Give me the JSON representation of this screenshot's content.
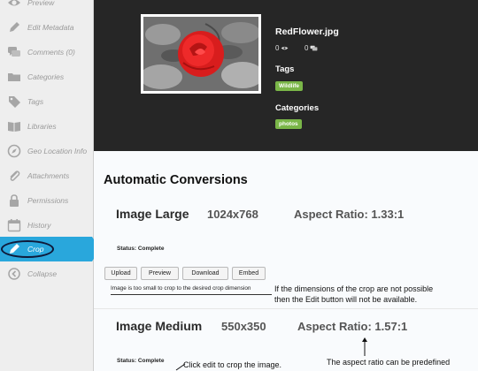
{
  "sidebar": {
    "items": [
      {
        "label": "Preview",
        "icon": "eye-icon"
      },
      {
        "label": "Edit Metadata",
        "icon": "pencil-icon"
      },
      {
        "label": "Comments (0)",
        "icon": "comments-icon"
      },
      {
        "label": "Categories",
        "icon": "folder-icon"
      },
      {
        "label": "Tags",
        "icon": "tag-icon"
      },
      {
        "label": "Libraries",
        "icon": "book-icon"
      },
      {
        "label": "Geo Location Info",
        "icon": "compass-icon"
      },
      {
        "label": "Attachments",
        "icon": "paperclip-icon"
      },
      {
        "label": "Permissions",
        "icon": "lock-icon"
      },
      {
        "label": "History",
        "icon": "calendar-icon"
      },
      {
        "label": "Crop",
        "icon": "crop-pen-icon",
        "active": true
      },
      {
        "label": "Collapse",
        "icon": "collapse-arrow-icon"
      }
    ]
  },
  "header": {
    "file_name": "RedFlower.jpg",
    "views": "0",
    "comments": "0",
    "tags_heading": "Tags",
    "tag": "Wildlife",
    "categories_heading": "Categories",
    "category": "photos",
    "colors": {
      "tag_green": "#7ab648",
      "header_bg": "#262626"
    }
  },
  "conversions": {
    "title": "Automatic Conversions",
    "large": {
      "name": "Image Large",
      "size": "1024x768",
      "aspect": "Aspect Ratio: 1.33:1",
      "status": "Status: Complete"
    },
    "buttons": {
      "upload": "Upload",
      "preview": "Preview",
      "download": "Download",
      "embed": "Embed"
    },
    "warning": "Image is too small to crop to the desired crop dimension",
    "medium": {
      "name": "Image Medium",
      "size": "550x350",
      "aspect": "Aspect Ratio: 1.57:1",
      "status": "Status: Complete"
    }
  },
  "annotations": {
    "note_crop_line1": "If the dimensions of the crop are not possible",
    "note_crop_line2": "then the Edit button will not be available.",
    "note_edit": "Click edit to crop the image.",
    "note_aspect": "The aspect ratio can be predefined"
  },
  "accent_color": "#29a7dc"
}
